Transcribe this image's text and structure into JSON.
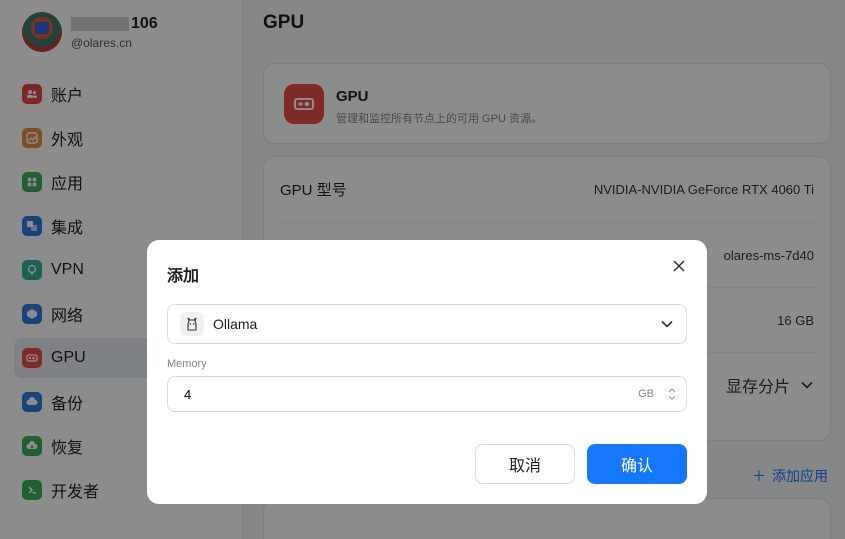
{
  "user": {
    "name_suffix": "106",
    "domain": "@olares.cn"
  },
  "nav": {
    "items": [
      {
        "label": "账户",
        "icon": "account-icon",
        "color": "#e04a4a"
      },
      {
        "label": "外观",
        "icon": "appearance-icon",
        "color": "#f08a3a"
      },
      {
        "label": "应用",
        "icon": "apps-icon",
        "color": "#3ab05b"
      },
      {
        "label": "集成",
        "icon": "integration-icon",
        "color": "#2b7de0"
      },
      {
        "label": "VPN",
        "icon": "vpn-icon",
        "color": "#2fb39a"
      },
      {
        "label": "网络",
        "icon": "network-icon",
        "color": "#2b7de0"
      },
      {
        "label": "GPU",
        "icon": "gpu-icon",
        "color": "#e94b4b"
      },
      {
        "label": "备份",
        "icon": "backup-icon",
        "color": "#2b7de0"
      },
      {
        "label": "恢复",
        "icon": "restore-icon",
        "color": "#3ab05b"
      },
      {
        "label": "开发者",
        "icon": "developer-icon",
        "color": "#3ab05b"
      }
    ],
    "active": "GPU"
  },
  "main": {
    "title": "GPU",
    "header_card": {
      "title": "GPU",
      "description": "管理和监控所有节点上的可用 GPU 资源。"
    },
    "rows": [
      {
        "label": "GPU 型号",
        "value": "NVIDIA-NVIDIA GeForce RTX 4060 Ti"
      },
      {
        "label": "",
        "value": "olares-ms-7d40"
      },
      {
        "label": "",
        "value": "16 GB"
      }
    ],
    "vram_mode": "显存分片",
    "add_app": "添加应用"
  },
  "dialog": {
    "title": "添加",
    "app_select": "Ollama",
    "memory_label": "Memory",
    "memory_value": "4",
    "memory_unit": "GB",
    "cancel": "取消",
    "confirm": "确认"
  },
  "colors": {
    "accent": "#1677ff",
    "gpu_red": "#e94b4b"
  }
}
